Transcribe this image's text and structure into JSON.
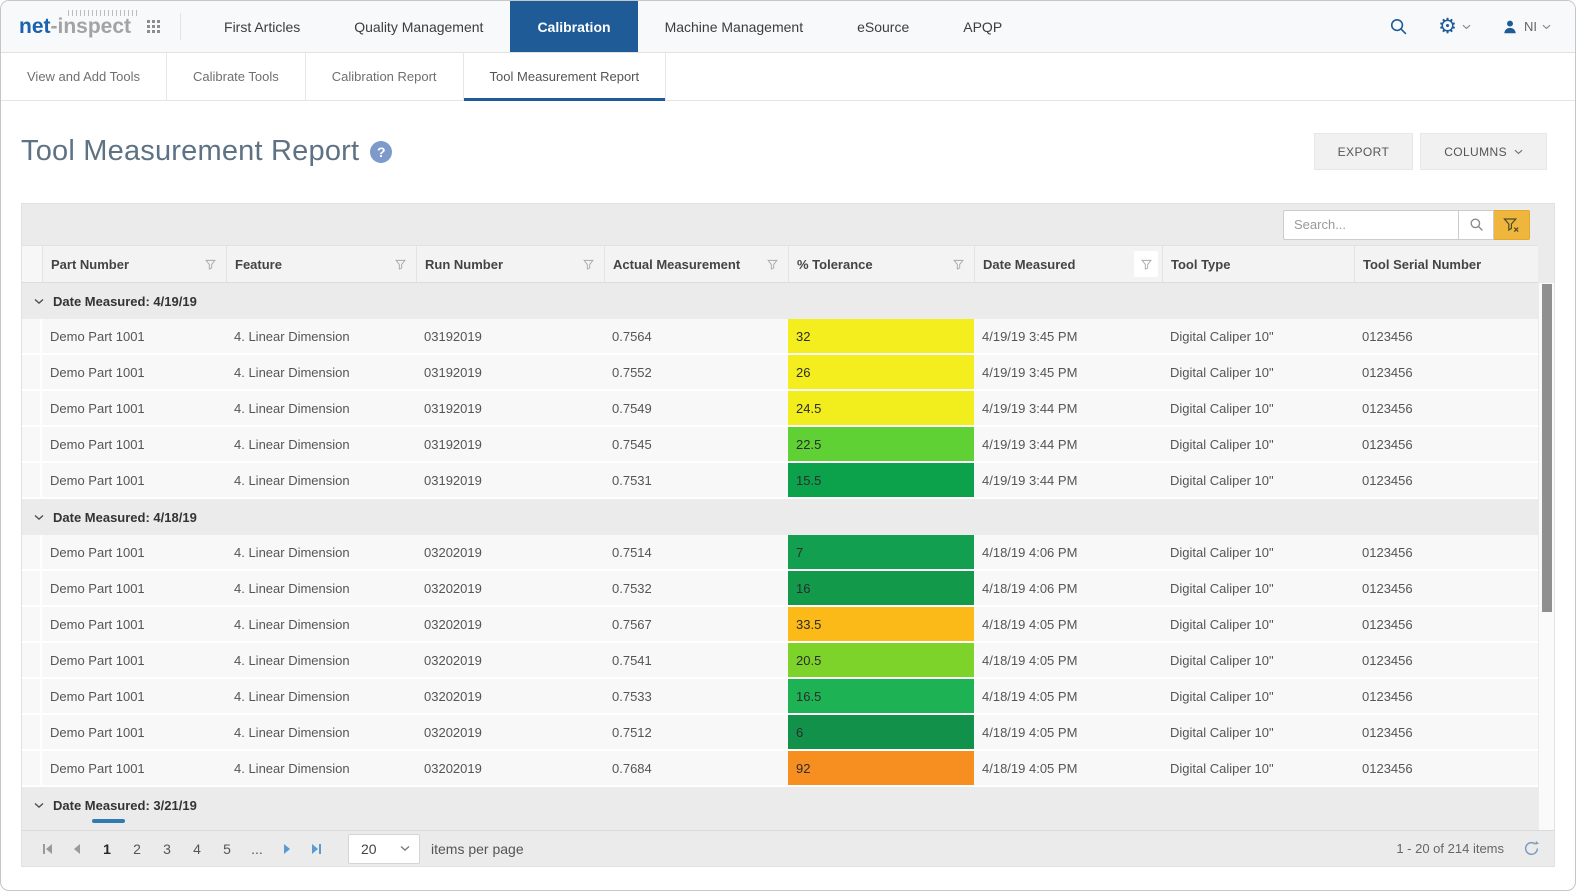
{
  "nav": {
    "logo_part1": "net",
    "logo_part2": "-inspect",
    "items": [
      {
        "label": "First Articles",
        "active": false
      },
      {
        "label": "Quality Management",
        "active": false
      },
      {
        "label": "Calibration",
        "active": true
      },
      {
        "label": "Machine Management",
        "active": false
      },
      {
        "label": "eSource",
        "active": false
      },
      {
        "label": "APQP",
        "active": false
      }
    ],
    "user_initials": "NI"
  },
  "subtabs": [
    {
      "label": "View and Add Tools",
      "active": false
    },
    {
      "label": "Calibrate Tools",
      "active": false
    },
    {
      "label": "Calibration Report",
      "active": false
    },
    {
      "label": "Tool Measurement Report",
      "active": true
    }
  ],
  "page": {
    "title": "Tool Measurement Report",
    "help_glyph": "?"
  },
  "actions": {
    "export_label": "EXPORT",
    "columns_label": "COLUMNS"
  },
  "grid": {
    "search_placeholder": "Search...",
    "columns": [
      {
        "label": "",
        "filterable": false
      },
      {
        "label": "Part Number",
        "filter_active": false
      },
      {
        "label": "Feature",
        "filter_active": false
      },
      {
        "label": "Run Number",
        "filter_active": false
      },
      {
        "label": "Actual Measurement",
        "filter_active": false
      },
      {
        "label": "% Tolerance",
        "filter_active": false
      },
      {
        "label": "Date Measured",
        "filter_active": true
      },
      {
        "label": "Tool Type",
        "filterable": false
      },
      {
        "label": "Tool Serial Number",
        "filterable": false
      }
    ],
    "groups": [
      {
        "label": "Date Measured: 4/19/19",
        "rows": [
          {
            "part": "Demo Part 1001",
            "feature": "4. Linear Dimension",
            "run": "03192019",
            "measurement": "0.7564",
            "tolerance": "32",
            "tolerance_color": "#f4ee1e",
            "date": "4/19/19 3:45 PM",
            "tool_type": "Digital Caliper 10\"",
            "serial": "0123456"
          },
          {
            "part": "Demo Part 1001",
            "feature": "4. Linear Dimension",
            "run": "03192019",
            "measurement": "0.7552",
            "tolerance": "26",
            "tolerance_color": "#f4ee1e",
            "date": "4/19/19 3:45 PM",
            "tool_type": "Digital Caliper 10\"",
            "serial": "0123456"
          },
          {
            "part": "Demo Part 1001",
            "feature": "4. Linear Dimension",
            "run": "03192019",
            "measurement": "0.7549",
            "tolerance": "24.5",
            "tolerance_color": "#f2ee1e",
            "date": "4/19/19 3:44 PM",
            "tool_type": "Digital Caliper 10\"",
            "serial": "0123456"
          },
          {
            "part": "Demo Part 1001",
            "feature": "4. Linear Dimension",
            "run": "03192019",
            "measurement": "0.7545",
            "tolerance": "22.5",
            "tolerance_color": "#5fd134",
            "date": "4/19/19 3:44 PM",
            "tool_type": "Digital Caliper 10\"",
            "serial": "0123456"
          },
          {
            "part": "Demo Part 1001",
            "feature": "4. Linear Dimension",
            "run": "03192019",
            "measurement": "0.7531",
            "tolerance": "15.5",
            "tolerance_color": "#0ca14b",
            "date": "4/19/19 3:44 PM",
            "tool_type": "Digital Caliper 10\"",
            "serial": "0123456"
          }
        ]
      },
      {
        "label": "Date Measured: 4/18/19",
        "rows": [
          {
            "part": "Demo Part 1001",
            "feature": "4. Linear Dimension",
            "run": "03202019",
            "measurement": "0.7514",
            "tolerance": "7",
            "tolerance_color": "#12a050",
            "date": "4/18/19 4:06 PM",
            "tool_type": "Digital Caliper 10\"",
            "serial": "0123456"
          },
          {
            "part": "Demo Part 1001",
            "feature": "4. Linear Dimension",
            "run": "03202019",
            "measurement": "0.7532",
            "tolerance": "16",
            "tolerance_color": "#12994a",
            "date": "4/18/19 4:06 PM",
            "tool_type": "Digital Caliper 10\"",
            "serial": "0123456"
          },
          {
            "part": "Demo Part 1001",
            "feature": "4. Linear Dimension",
            "run": "03202019",
            "measurement": "0.7567",
            "tolerance": "33.5",
            "tolerance_color": "#fbba17",
            "date": "4/18/19 4:05 PM",
            "tool_type": "Digital Caliper 10\"",
            "serial": "0123456"
          },
          {
            "part": "Demo Part 1001",
            "feature": "4. Linear Dimension",
            "run": "03202019",
            "measurement": "0.7541",
            "tolerance": "20.5",
            "tolerance_color": "#7ed32b",
            "date": "4/18/19 4:05 PM",
            "tool_type": "Digital Caliper 10\"",
            "serial": "0123456"
          },
          {
            "part": "Demo Part 1001",
            "feature": "4. Linear Dimension",
            "run": "03202019",
            "measurement": "0.7533",
            "tolerance": "16.5",
            "tolerance_color": "#1db254",
            "date": "4/18/19 4:05 PM",
            "tool_type": "Digital Caliper 10\"",
            "serial": "0123456"
          },
          {
            "part": "Demo Part 1001",
            "feature": "4. Linear Dimension",
            "run": "03202019",
            "measurement": "0.7512",
            "tolerance": "6",
            "tolerance_color": "#12914a",
            "date": "4/18/19 4:05 PM",
            "tool_type": "Digital Caliper 10\"",
            "serial": "0123456"
          },
          {
            "part": "Demo Part 1001",
            "feature": "4. Linear Dimension",
            "run": "03202019",
            "measurement": "0.7684",
            "tolerance": "92",
            "tolerance_color": "#f78f20",
            "date": "4/18/19 4:05 PM",
            "tool_type": "Digital Caliper 10\"",
            "serial": "0123456"
          }
        ]
      },
      {
        "label": "Date Measured: 3/21/19",
        "underline": true,
        "rows": []
      }
    ],
    "pager": {
      "pages": [
        "1",
        "2",
        "3",
        "4",
        "5"
      ],
      "current": "1",
      "ellipsis": "...",
      "page_size": "20",
      "items_per_page_label": "items per page",
      "summary": "1 - 20 of 214 items"
    }
  }
}
